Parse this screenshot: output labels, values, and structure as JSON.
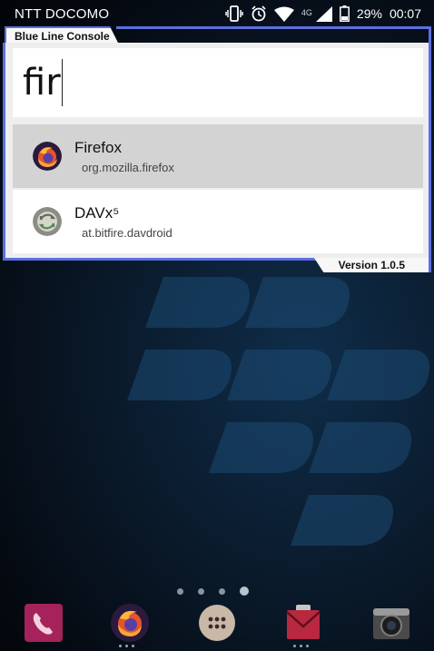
{
  "status_bar": {
    "carrier": "NTT DOCOMO",
    "network": "4G",
    "battery": "29%",
    "time": "00:07"
  },
  "console": {
    "title": "Blue Line Console",
    "input_value": "fir",
    "version": "Version 1.0.5",
    "accent_color": "#5b6fe0",
    "results": [
      {
        "title": "Firefox",
        "package": "org.mozilla.firefox"
      },
      {
        "title": "DAVx⁵",
        "package": "at.bitfire.davdroid"
      }
    ]
  },
  "home": {
    "pages": 4,
    "active_page": 4,
    "dock": [
      "phone-icon",
      "firefox-icon",
      "app-drawer-icon",
      "email-icon",
      "camera-icon"
    ]
  }
}
